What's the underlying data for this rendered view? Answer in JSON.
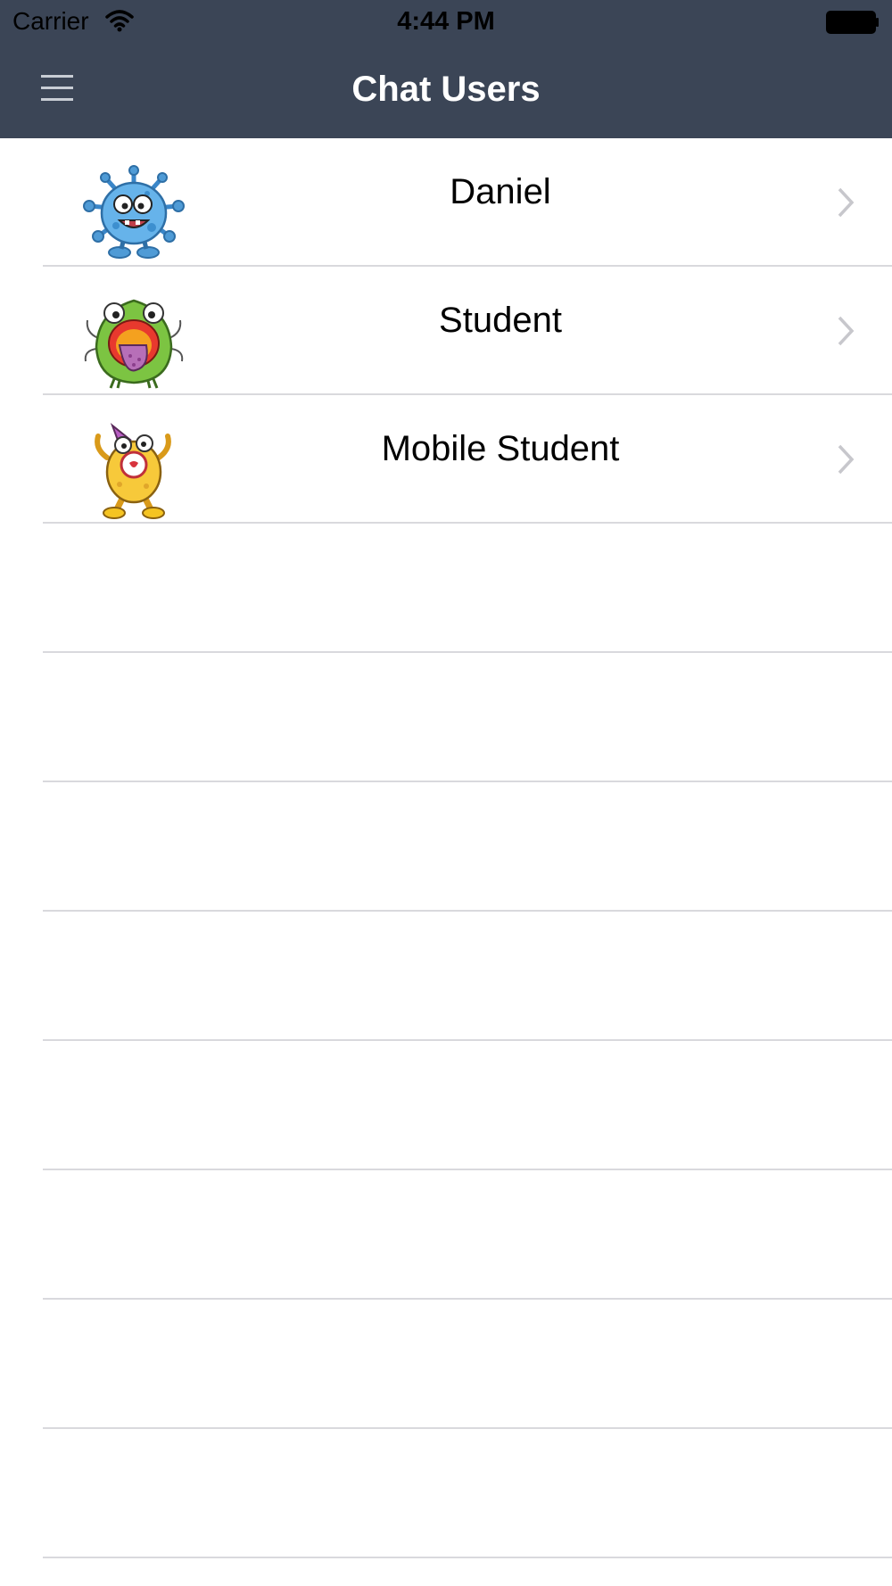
{
  "status_bar": {
    "carrier": "Carrier",
    "time": "4:44 PM",
    "wifi_icon": "wifi-icon",
    "battery_icon": "battery-icon"
  },
  "nav": {
    "title": "Chat Users",
    "menu_icon": "hamburger-menu-icon",
    "background_color": "#3b4556"
  },
  "users": [
    {
      "name": "Daniel",
      "avatar": "blue-virus-monster-avatar"
    },
    {
      "name": "Student",
      "avatar": "green-tongue-monster-avatar"
    },
    {
      "name": "Mobile Student",
      "avatar": "yellow-party-hat-monster-avatar"
    }
  ],
  "empty_rows_count_visible": 8
}
